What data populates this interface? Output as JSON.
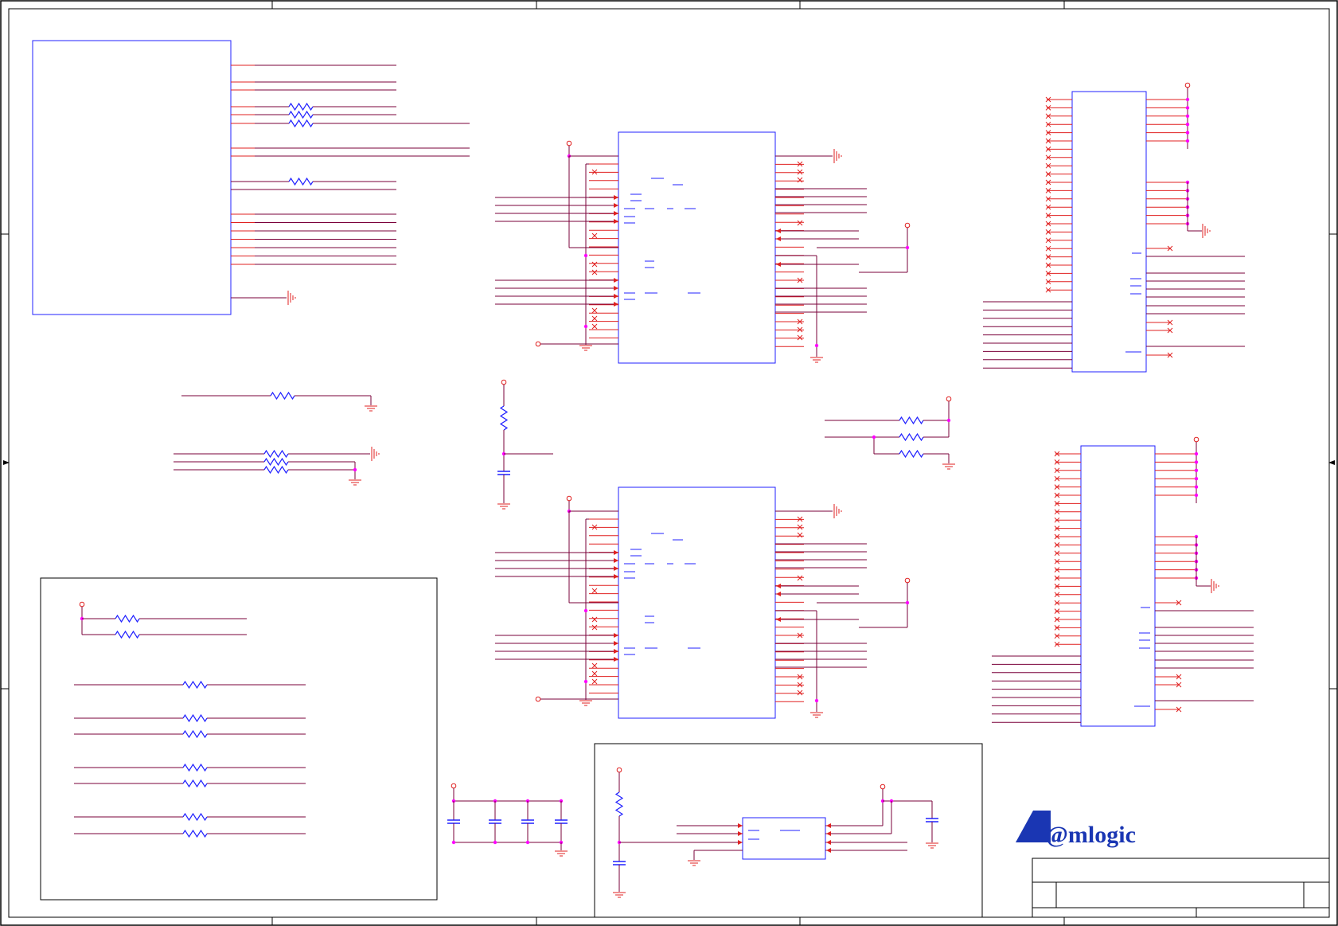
{
  "drawing": {
    "title_block": {
      "logo_text": "@mlogic"
    }
  },
  "colors": {
    "wire": "#7a003a",
    "pin": "#e02020",
    "component_body": "#2020ff",
    "junction": "#ff00ff",
    "border": "#000000",
    "logo": "#1a36b3"
  },
  "icons": {
    "ground": "ground-symbol-icon",
    "chassis_ground": "chassis-ground-icon",
    "no_connect": "no-connect-x-icon",
    "power_port": "power-port-circle-icon",
    "resistor": "resistor-zigzag-icon",
    "capacitor": "capacitor-icon"
  }
}
